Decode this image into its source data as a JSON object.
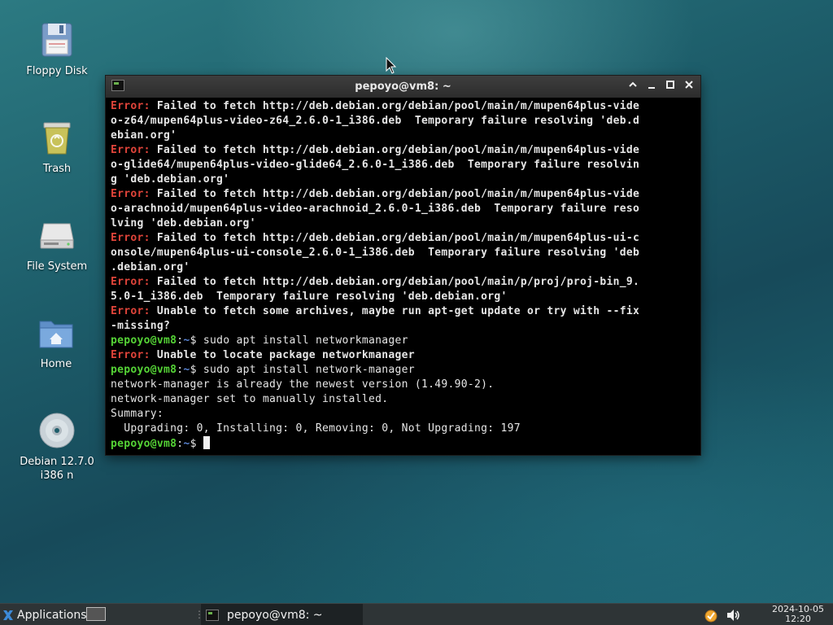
{
  "desktop_icons": [
    {
      "label": "Floppy Disk",
      "icon": "floppy-disk-icon"
    },
    {
      "label": "Trash",
      "icon": "trash-icon"
    },
    {
      "label": "File System",
      "icon": "hard-drive-icon"
    },
    {
      "label": "Home",
      "icon": "home-folder-icon"
    },
    {
      "label": "Debian 12.7.0",
      "label2": "i386 n",
      "icon": "optical-disc-icon"
    }
  ],
  "terminal": {
    "title": "pepoyo@vm8: ~",
    "buttons": [
      "shade",
      "minimize",
      "maximize",
      "close"
    ],
    "lines": [
      [
        {
          "t": "Error:",
          "c": "err"
        },
        {
          "t": " Failed to fetch http://deb.debian.org/debian/pool/main/m/mupen64plus-vide",
          "c": "bold"
        }
      ],
      [
        {
          "t": "o-z64/mupen64plus-video-z64_2.6.0-1_i386.deb  Temporary failure resolving 'deb.d",
          "c": "bold"
        }
      ],
      [
        {
          "t": "ebian.org'",
          "c": "bold"
        }
      ],
      [
        {
          "t": "Error:",
          "c": "err"
        },
        {
          "t": " Failed to fetch http://deb.debian.org/debian/pool/main/m/mupen64plus-vide",
          "c": "bold"
        }
      ],
      [
        {
          "t": "o-glide64/mupen64plus-video-glide64_2.6.0-1_i386.deb  Temporary failure resolvin",
          "c": "bold"
        }
      ],
      [
        {
          "t": "g 'deb.debian.org'",
          "c": "bold"
        }
      ],
      [
        {
          "t": "Error:",
          "c": "err"
        },
        {
          "t": " Failed to fetch http://deb.debian.org/debian/pool/main/m/mupen64plus-vide",
          "c": "bold"
        }
      ],
      [
        {
          "t": "o-arachnoid/mupen64plus-video-arachnoid_2.6.0-1_i386.deb  Temporary failure reso",
          "c": "bold"
        }
      ],
      [
        {
          "t": "lving 'deb.debian.org'",
          "c": "bold"
        }
      ],
      [
        {
          "t": "Error:",
          "c": "err"
        },
        {
          "t": " Failed to fetch http://deb.debian.org/debian/pool/main/m/mupen64plus-ui-c",
          "c": "bold"
        }
      ],
      [
        {
          "t": "onsole/mupen64plus-ui-console_2.6.0-1_i386.deb  Temporary failure resolving 'deb",
          "c": "bold"
        }
      ],
      [
        {
          "t": ".debian.org'",
          "c": "bold"
        }
      ],
      [
        {
          "t": "Error:",
          "c": "err"
        },
        {
          "t": " Failed to fetch http://deb.debian.org/debian/pool/main/p/proj/proj-bin_9.",
          "c": "bold"
        }
      ],
      [
        {
          "t": "5.0-1_i386.deb  Temporary failure resolving 'deb.debian.org'",
          "c": "bold"
        }
      ],
      [
        {
          "t": "Error:",
          "c": "err"
        },
        {
          "t": " Unable to fetch some archives, maybe run apt-get update or try with --fix",
          "c": "bold"
        }
      ],
      [
        {
          "t": "-missing?",
          "c": "bold"
        }
      ],
      [
        {
          "t": "pepoyo@vm8",
          "c": "usr"
        },
        {
          "t": ":",
          "c": ""
        },
        {
          "t": "~",
          "c": "path"
        },
        {
          "t": "$ sudo apt install networkmanager",
          "c": ""
        }
      ],
      [
        {
          "t": "Error:",
          "c": "err"
        },
        {
          "t": " Unable to locate package networkmanager",
          "c": "bold"
        }
      ],
      [
        {
          "t": "pepoyo@vm8",
          "c": "usr"
        },
        {
          "t": ":",
          "c": ""
        },
        {
          "t": "~",
          "c": "path"
        },
        {
          "t": "$ sudo apt install network-manager",
          "c": ""
        }
      ],
      [
        {
          "t": "network-manager is already the newest version (1.49.90-2).",
          "c": ""
        }
      ],
      [
        {
          "t": "network-manager set to manually installed.",
          "c": ""
        }
      ],
      [
        {
          "t": "Summary:",
          "c": ""
        }
      ],
      [
        {
          "t": "  Upgrading: 0, Installing: 0, Removing: 0, Not Upgrading: 197",
          "c": ""
        }
      ],
      [
        {
          "t": "pepoyo@vm8",
          "c": "usr"
        },
        {
          "t": ":",
          "c": ""
        },
        {
          "t": "~",
          "c": "path"
        },
        {
          "t": "$ ",
          "c": ""
        },
        {
          "t": "",
          "c": "cursor"
        }
      ]
    ]
  },
  "taskbar": {
    "apps_label": "Applications",
    "task_label": "pepoyo@vm8: ~",
    "clock_date": "2024-10-05",
    "clock_time": "12:20"
  },
  "colors": {
    "error": "#e0443a",
    "user": "#55d336",
    "path": "#5b86d6",
    "desktop": "#1d5d6a"
  }
}
